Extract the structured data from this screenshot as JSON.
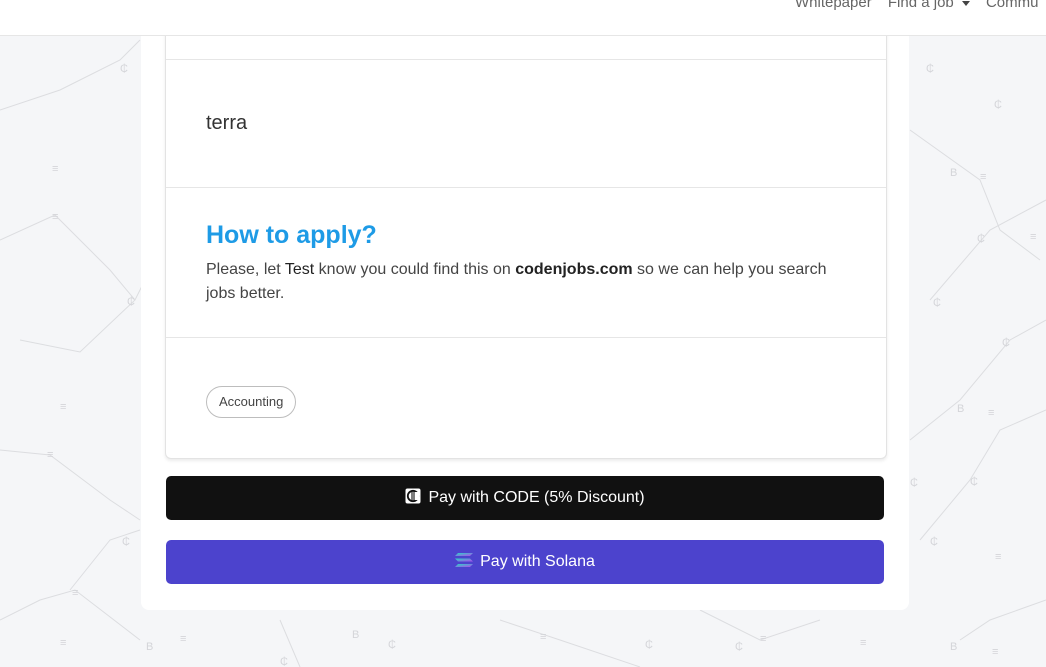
{
  "nav": {
    "links": [
      "Whitepaper",
      "Find a job",
      "Commu"
    ]
  },
  "job": {
    "tech_text": "terra",
    "apply": {
      "heading": "How to apply?",
      "text_before_company": "Please, let ",
      "company": "Test",
      "text_after_company": " know you could find this on ",
      "site": "codenjobs.com",
      "text_end": " so we can help you search jobs better."
    },
    "tags": [
      "Accounting"
    ]
  },
  "payment": {
    "code_label": "Pay with CODE (5% Discount)",
    "solana_label": "Pay with Solana"
  },
  "colors": {
    "heading_blue": "#1e9be6",
    "code_button": "#111111",
    "solana_button": "#4c43cd"
  },
  "icons": {
    "code": "code-coin-icon",
    "solana": "solana-icon",
    "dropdown": "caret-down-icon"
  }
}
